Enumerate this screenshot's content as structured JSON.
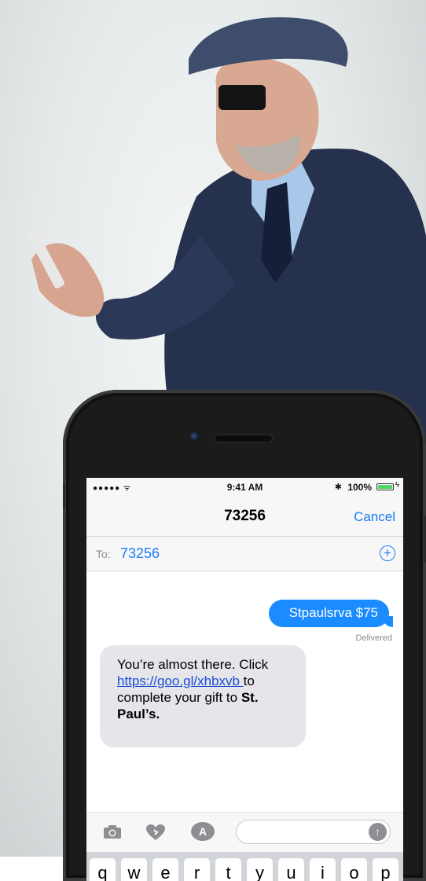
{
  "status_bar": {
    "signal": "●●●●● ᯤ",
    "time": "9:41 AM",
    "bluetooth": "✱",
    "battery_percent": "100%",
    "battery_level": 1.0,
    "charging": "ϟ"
  },
  "nav": {
    "title": "73256",
    "cancel_label": "Cancel"
  },
  "recipient": {
    "to_label": "To:",
    "number": "73256",
    "add_icon": "plus-circle-icon"
  },
  "messages": {
    "sent_text": "Stpaulsrva $75",
    "delivered_label": "Delivered",
    "received_prefix": "You’re almost there. Click ",
    "received_link": "https://goo.gl/xhbxvb ",
    "received_mid": "to complete your gift to ",
    "received_bold": "St. Paul’s."
  },
  "input_bar": {
    "camera_icon": "camera-icon",
    "heart_icon": "digital-touch-icon",
    "apps_icon": "app-store-icon",
    "apps_glyph": "A",
    "send_icon": "send-arrow-icon",
    "send_glyph": "↑"
  },
  "keyboard": {
    "keys": [
      "q",
      "w",
      "e",
      "r",
      "t",
      "y",
      "u",
      "i",
      "o",
      "p"
    ]
  },
  "colors": {
    "accent": "#1a7cf5",
    "sent_bubble": "#1a8cff",
    "received_bubble": "#e5e5ea",
    "link": "#1a4fd6",
    "battery": "#4cd964"
  }
}
